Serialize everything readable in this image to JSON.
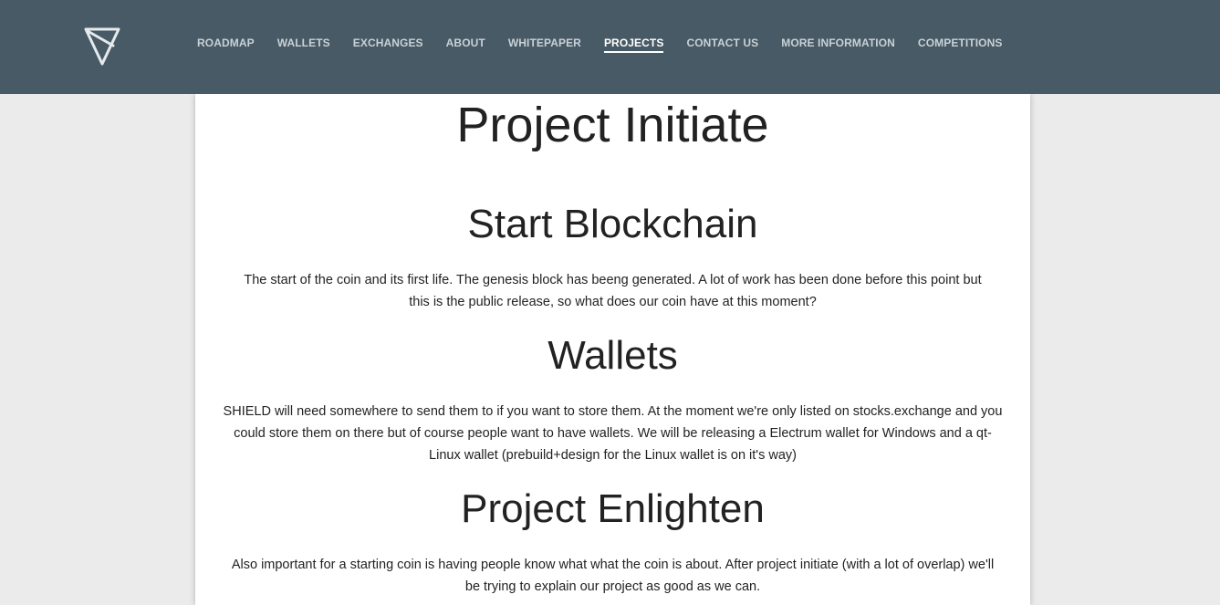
{
  "nav": {
    "links": [
      {
        "label": "ROADMAP",
        "active": false
      },
      {
        "label": "WALLETS",
        "active": false
      },
      {
        "label": "EXCHANGES",
        "active": false
      },
      {
        "label": "ABOUT",
        "active": false
      },
      {
        "label": "WHITEPAPER",
        "active": false
      },
      {
        "label": "PROJECTS",
        "active": true
      },
      {
        "label": "CONTACT US",
        "active": false
      },
      {
        "label": "MORE INFORMATION",
        "active": false
      },
      {
        "label": "COMPETITIONS",
        "active": false
      }
    ],
    "logo_icon": "triangle-logo-icon"
  },
  "content": {
    "title": "Project Initiate",
    "sections": [
      {
        "heading": "Start Blockchain",
        "body": "The start of the coin and its first life. The genesis block has beeng generated. A lot of work has been done before this point but this is the public release, so what does our coin have at this moment?"
      },
      {
        "heading": "Wallets",
        "body": "SHIELD will need somewhere to send them to if you want to store them. At the moment we're only listed on stocks.exchange and you could store them on there but of course people want to have wallets. We will be releasing a Electrum wallet for Windows and a qt-Linux wallet (prebuild+design for the Linux wallet is on it's way)"
      },
      {
        "heading": "Project Enlighten",
        "body": "Also important for a starting coin is having people know what what the coin is about. After project initiate (with a lot of overlap) we'll be trying to explain our project as good as we can."
      }
    ]
  },
  "colors": {
    "navbar_bg": "#485a66",
    "nav_text": "#c9d1d6",
    "nav_active": "#ffffff",
    "page_bg": "#ebebeb",
    "panel_bg": "#ffffff",
    "text": "#222222"
  }
}
